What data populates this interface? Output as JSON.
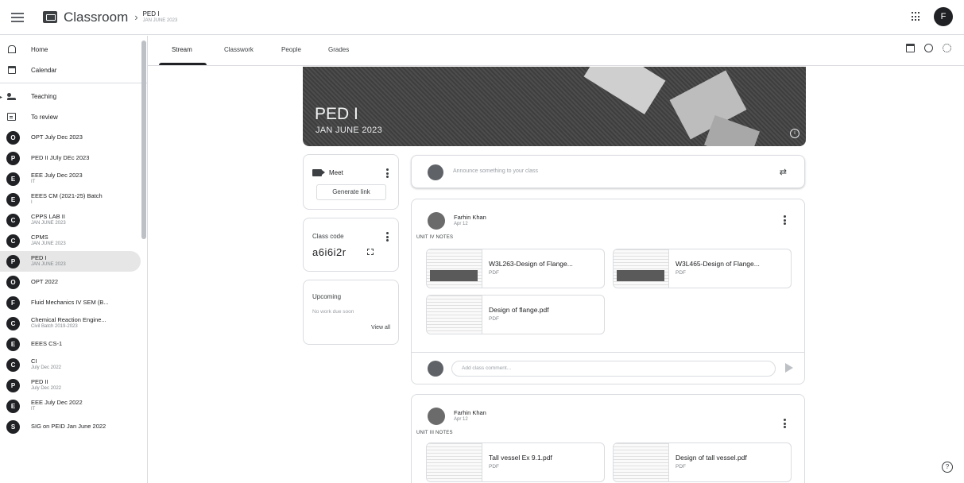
{
  "topbar": {
    "app_name": "Classroom",
    "crumb_separator": "›",
    "crumb_title": "PED I",
    "crumb_subtitle": "JAN JUNE 2023",
    "avatar_letter": "F"
  },
  "sidebar": {
    "home": "Home",
    "calendar": "Calendar",
    "teaching": "Teaching",
    "to_review": "To review",
    "classes": [
      {
        "letter": "O",
        "name": "OPT July Dec 2023",
        "sub": ""
      },
      {
        "letter": "P",
        "name": "PED II JUly DEc 2023",
        "sub": ""
      },
      {
        "letter": "E",
        "name": "EEE July Dec 2023",
        "sub": "IT"
      },
      {
        "letter": "E",
        "name": "EEES CM (2021-25) Batch",
        "sub": "I"
      },
      {
        "letter": "C",
        "name": "CPPS LAB II",
        "sub": "JAN JUNE 2023"
      },
      {
        "letter": "C",
        "name": "CPMS",
        "sub": "JAN JUNE 2023"
      },
      {
        "letter": "P",
        "name": "PED I",
        "sub": "JAN JUNE 2023"
      },
      {
        "letter": "O",
        "name": "OPT 2022",
        "sub": ""
      },
      {
        "letter": "F",
        "name": "Fluid Mechanics IV SEM (B...",
        "sub": ""
      },
      {
        "letter": "C",
        "name": "Chemical Reaction Engine...",
        "sub": "Civil Batch 2019-2023"
      },
      {
        "letter": "E",
        "name": "EEES CS-1",
        "sub": ""
      },
      {
        "letter": "C",
        "name": "CI",
        "sub": "July Dec 2022"
      },
      {
        "letter": "P",
        "name": "PED II",
        "sub": "July Dec 2022"
      },
      {
        "letter": "E",
        "name": "EEE July Dec 2022",
        "sub": "IT"
      },
      {
        "letter": "S",
        "name": "SIG on PEID Jan June 2022",
        "sub": ""
      }
    ]
  },
  "tabs": {
    "stream": "Stream",
    "classwork": "Classwork",
    "people": "People",
    "grades": "Grades"
  },
  "banner": {
    "title": "PED I",
    "subtitle": "JAN JUNE 2023",
    "info": "i"
  },
  "meet": {
    "label": "Meet",
    "generate_link": "Generate link"
  },
  "class_code": {
    "label": "Class code",
    "value": "a6i6i2r"
  },
  "upcoming": {
    "label": "Upcoming",
    "none": "No work due soon",
    "view_all": "View all"
  },
  "announce": {
    "placeholder": "Announce something to your class"
  },
  "posts": [
    {
      "author": "Farhin Khan",
      "date": "Apr 12",
      "text": "UNIT IV NOTES",
      "attachments": [
        {
          "title": "W3L263-Design of Flange...",
          "type": "PDF"
        },
        {
          "title": "W3L465-Design of Flange...",
          "type": "PDF"
        },
        {
          "title": "Design of flange.pdf",
          "type": "PDF"
        }
      ],
      "comment_placeholder": "Add class comment..."
    },
    {
      "author": "Farhin Khan",
      "date": "Apr 12",
      "text": "UNIT III NOTES",
      "attachments": [
        {
          "title": "Tall vessel Ex 9.1.pdf",
          "type": "PDF"
        },
        {
          "title": "Design of tall vessel.pdf",
          "type": "PDF"
        }
      ]
    }
  ],
  "help": "?"
}
